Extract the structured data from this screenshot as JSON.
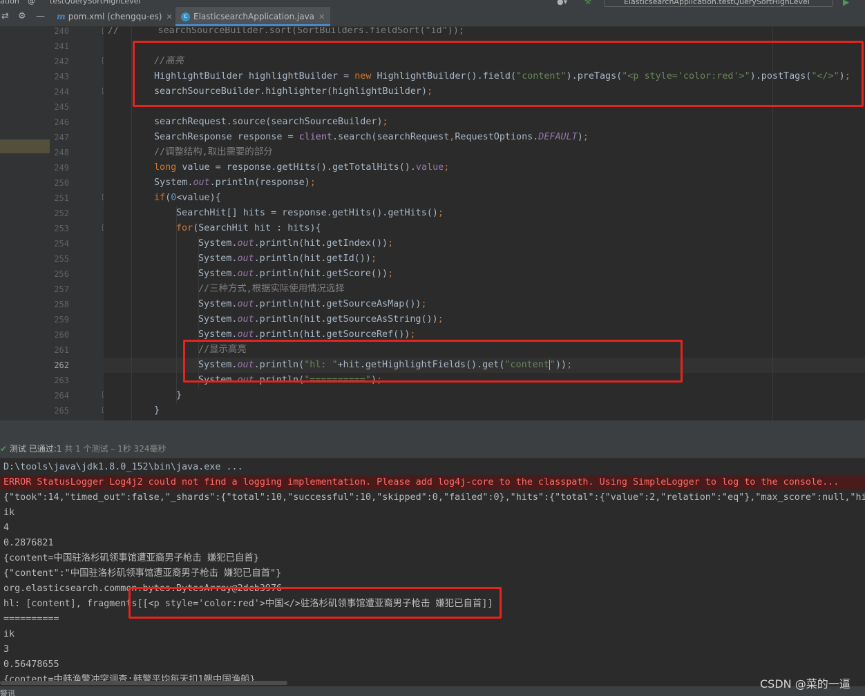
{
  "topbar": {
    "left_fragment": "ation",
    "mid_fragment": "@",
    "breadcrumb_method": "testQuerySortHighLevel",
    "run_config": "ElasticsearchApplication.testQuerySortHighLevel"
  },
  "tabs": [
    {
      "icon": "m",
      "label": "pom.xml (chengqu-es)",
      "active": false
    },
    {
      "icon": "c",
      "label": "ElasticsearchApplication.java",
      "active": true
    }
  ],
  "code_lines": [
    {
      "num": "240",
      "text": "//       searchSourceBuilder.sort(SortBuilders.fieldSort(\"id\"));"
    },
    {
      "num": "241",
      "text": ""
    },
    {
      "num": "242",
      "text": "//高亮"
    },
    {
      "num": "243",
      "text": "HighlightBuilder highlightBuilder = new HighlightBuilder().field(\"content\").preTags(\"<p style='color:red'>\").postTags(\"</>\");"
    },
    {
      "num": "244",
      "text": "searchSourceBuilder.highlighter(highlightBuilder);"
    },
    {
      "num": "245",
      "text": ""
    },
    {
      "num": "246",
      "text": "searchRequest.source(searchSourceBuilder);"
    },
    {
      "num": "247",
      "text": "SearchResponse response = client.search(searchRequest,RequestOptions.DEFAULT);"
    },
    {
      "num": "248",
      "text": "//调整结构,取出需要的部分"
    },
    {
      "num": "249",
      "text": "long value = response.getHits().getTotalHits().value;"
    },
    {
      "num": "250",
      "text": "System.out.println(response);"
    },
    {
      "num": "251",
      "text": "if(0<value){"
    },
    {
      "num": "252",
      "text": "SearchHit[] hits = response.getHits().getHits();"
    },
    {
      "num": "253",
      "text": "for(SearchHit hit : hits){"
    },
    {
      "num": "254",
      "text": "System.out.println(hit.getIndex());"
    },
    {
      "num": "255",
      "text": "System.out.println(hit.getId());"
    },
    {
      "num": "256",
      "text": "System.out.println(hit.getScore());"
    },
    {
      "num": "257",
      "text": "//三种方式,根据实际使用情况选择"
    },
    {
      "num": "258",
      "text": "System.out.println(hit.getSourceAsMap());"
    },
    {
      "num": "259",
      "text": "System.out.println(hit.getSourceAsString());"
    },
    {
      "num": "260",
      "text": "System.out.println(hit.getSourceRef());"
    },
    {
      "num": "261",
      "text": "//显示高亮"
    },
    {
      "num": "262",
      "text": "System.out.println(\"hl: \"+hit.getHighlightFields().get(\"content\"));"
    },
    {
      "num": "263",
      "text": "System.out.println(\"==========\");"
    },
    {
      "num": "264",
      "text": "}"
    },
    {
      "num": "265",
      "text": "}"
    }
  ],
  "run": {
    "status_label": "测试 已通过:",
    "passed_count": "1",
    "summary": "共 1 个测试 – 1秒 324毫秒"
  },
  "console_lines": [
    "D:\\tools\\java\\jdk1.8.0_152\\bin\\java.exe ...",
    "ERROR StatusLogger Log4j2 could not find a logging implementation. Please add log4j-core to the classpath. Using SimpleLogger to log to the console...",
    "{\"took\":14,\"timed_out\":false,\"_shards\":{\"total\":10,\"successful\":10,\"skipped\":0,\"failed\":0},\"hits\":{\"total\":{\"value\":2,\"relation\":\"eq\"},\"max_score\":null,\"hit",
    "ik",
    "4",
    "0.2876821",
    "{content=中国驻洛杉矶领事馆遭亚裔男子枪击 嫌犯已自首}",
    "{\"content\":\"中国驻洛杉矶领事馆遭亚裔男子枪击 嫌犯已自首\"}",
    "org.elasticsearch.common.bytes.BytesArray@2dcb3976",
    "hl: [content], fragments[[<p style='color:red'>中国</>驻洛杉矶领事馆遭亚裔男子枪击 嫌犯已自首]]",
    "==========",
    "ik",
    "3",
    "0.56478655",
    "{content=中韩渔警冲突调查:韩警平均每天扣1艘中国渔船}"
  ],
  "statusbar_text": "警讯",
  "watermark": "CSDN @菜的一逼",
  "colors": {
    "highlight_box": "#e8231d",
    "accent": "#4a88c7",
    "pass_green": "#499c54"
  }
}
